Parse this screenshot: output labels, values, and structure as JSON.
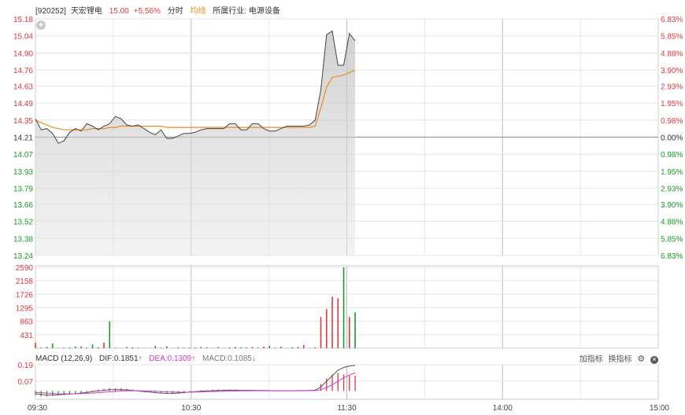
{
  "header": {
    "code": "[920252]",
    "name": "天宏锂电",
    "price": "15.00",
    "change_pct": "+5.56%",
    "mode": "分时",
    "avg_label": "均线",
    "industry_label": "所属行业: 电源设备"
  },
  "macd_header": {
    "title": "MACD (12,26,9)",
    "dif": "DIF:0.1851",
    "dif_arrow": "↑",
    "dea": "DEA:0.1309",
    "dea_arrow": "↑",
    "macd": "MACD:0.1085",
    "macd_arrow": "↓"
  },
  "toolbar": {
    "add_indicator": "加指标",
    "switch_indicator": "换指标"
  },
  "icons": {
    "expand": "plus-circle-icon",
    "settings": "gear-icon",
    "close": "close-icon"
  },
  "colors": {
    "up": "#e0393e",
    "down": "#1a9a2a",
    "price_line": "#444444",
    "avg_line": "#f08a20",
    "dea_line": "#d63ad0",
    "grid": "#d9d9d9"
  },
  "chart_data": [
    {
      "type": "line",
      "x_ticks": [
        "09:30",
        "10:30",
        "11:30",
        "14:00",
        "15:00"
      ],
      "y_ticks_left": [
        "15.18",
        "15.04",
        "14.90",
        "14.76",
        "14.63",
        "14.49",
        "14.35",
        "14.21",
        "14.07",
        "13.93",
        "13.79",
        "13.66",
        "13.52",
        "13.38",
        "13.24"
      ],
      "y_ticks_right": [
        "6.83%",
        "5.85%",
        "4.88%",
        "3.90%",
        "2.93%",
        "1.95%",
        "0.98%",
        "0.00%",
        "0.98%",
        "1.95%",
        "2.93%",
        "3.90%",
        "4.88%",
        "5.85%",
        "6.83%"
      ],
      "ylim": [
        13.24,
        15.18
      ],
      "prev_close": 14.21,
      "series": [
        {
          "values": [
            14.36,
            14.27,
            14.28,
            14.24,
            14.16,
            14.18,
            14.25,
            14.28,
            14.26,
            14.32,
            14.3,
            14.27,
            14.3,
            14.32,
            14.38,
            14.36,
            14.31,
            14.3,
            14.31,
            14.28,
            14.25,
            14.23,
            14.27,
            14.2,
            14.2,
            14.22,
            14.24,
            14.24,
            14.25,
            14.27,
            14.28,
            14.28,
            14.28,
            14.28,
            14.32,
            14.32,
            14.27,
            14.27,
            14.32,
            14.32,
            14.28,
            14.26,
            14.26,
            14.28,
            14.3,
            14.3,
            14.3,
            14.3,
            14.31,
            14.35,
            14.6,
            15.05,
            15.08,
            14.8,
            14.8,
            15.06,
            15.0
          ]
        },
        {
          "values": [
            14.35,
            14.33,
            14.31,
            14.29,
            14.28,
            14.27,
            14.27,
            14.27,
            14.27,
            14.27,
            14.28,
            14.28,
            14.28,
            14.29,
            14.29,
            14.3,
            14.3,
            14.3,
            14.3,
            14.3,
            14.3,
            14.3,
            14.3,
            14.29,
            14.29,
            14.29,
            14.29,
            14.29,
            14.29,
            14.29,
            14.29,
            14.29,
            14.29,
            14.29,
            14.29,
            14.29,
            14.29,
            14.29,
            14.29,
            14.29,
            14.29,
            14.29,
            14.29,
            14.29,
            14.29,
            14.29,
            14.29,
            14.29,
            14.29,
            14.3,
            14.45,
            14.62,
            14.7,
            14.71,
            14.72,
            14.74,
            14.76
          ]
        }
      ]
    },
    {
      "type": "bar",
      "y_ticks": [
        "2590",
        "2158",
        "1726",
        "1295",
        "863",
        "431"
      ],
      "ylim": [
        0,
        2590
      ],
      "values": [
        180,
        20,
        40,
        150,
        10,
        20,
        30,
        50,
        60,
        20,
        120,
        30,
        180,
        860,
        20,
        10,
        40,
        30,
        20,
        10,
        10,
        80,
        20,
        60,
        10,
        30,
        20,
        20,
        30,
        40,
        30,
        10,
        40,
        10,
        30,
        40,
        30,
        30,
        40,
        20,
        50,
        80,
        20,
        50,
        10,
        30,
        40,
        100,
        10,
        30,
        1000,
        1250,
        1650,
        1600,
        2590,
        1000,
        1150
      ],
      "up": [
        true,
        false,
        false,
        false,
        false,
        true,
        true,
        false,
        true,
        false,
        false,
        true,
        true,
        false,
        false,
        true,
        false,
        true,
        false,
        true,
        false,
        false,
        true,
        false,
        true,
        false,
        true,
        false,
        true,
        false,
        true,
        false,
        true,
        false,
        true,
        false,
        true,
        false,
        true,
        false,
        true,
        false,
        true,
        false,
        true,
        false,
        true,
        true,
        false,
        true,
        true,
        true,
        true,
        true,
        false,
        true,
        false
      ]
    },
    {
      "type": "bar",
      "y_ticks": [
        "0.19",
        "0.07"
      ],
      "ylim": [
        -0.06,
        0.19
      ],
      "macd": [
        -0.03,
        -0.04,
        -0.04,
        -0.035,
        -0.03,
        -0.03,
        -0.025,
        -0.02,
        -0.015,
        -0.01,
        0.005,
        0.01,
        0.015,
        0.02,
        0.02,
        0.02,
        0.015,
        0.01,
        0.005,
        0.0,
        -0.005,
        -0.01,
        -0.015,
        -0.02,
        -0.02,
        -0.015,
        -0.01,
        -0.005,
        0.0,
        0.005,
        0.005,
        0.01,
        0.01,
        0.01,
        0.01,
        0.01,
        0.005,
        0.005,
        0.005,
        0.005,
        0.005,
        0.005,
        0.0,
        0.0,
        0.0,
        0.0,
        0.005,
        0.005,
        0.005,
        0.01,
        0.05,
        0.09,
        0.12,
        0.13,
        0.12,
        0.11,
        0.11
      ],
      "dif": [
        -0.02,
        -0.025,
        -0.03,
        -0.03,
        -0.028,
        -0.025,
        -0.022,
        -0.02,
        -0.015,
        -0.01,
        -0.005,
        0.0,
        0.005,
        0.01,
        0.01,
        0.01,
        0.008,
        0.005,
        0.0,
        -0.005,
        -0.008,
        -0.012,
        -0.015,
        -0.018,
        -0.018,
        -0.015,
        -0.012,
        -0.008,
        -0.005,
        -0.002,
        0.0,
        0.002,
        0.004,
        0.005,
        0.006,
        0.006,
        0.005,
        0.005,
        0.005,
        0.004,
        0.004,
        0.003,
        0.002,
        0.002,
        0.002,
        0.002,
        0.003,
        0.003,
        0.004,
        0.006,
        0.03,
        0.07,
        0.11,
        0.15,
        0.17,
        0.18,
        0.1851
      ],
      "dea": [
        -0.01,
        -0.012,
        -0.015,
        -0.018,
        -0.02,
        -0.021,
        -0.021,
        -0.02,
        -0.019,
        -0.017,
        -0.015,
        -0.012,
        -0.009,
        -0.006,
        -0.003,
        0.0,
        0.001,
        0.002,
        0.002,
        0.001,
        0.0,
        -0.002,
        -0.004,
        -0.006,
        -0.008,
        -0.009,
        -0.009,
        -0.009,
        -0.008,
        -0.007,
        -0.005,
        -0.004,
        -0.003,
        -0.002,
        -0.001,
        0.0,
        0.001,
        0.001,
        0.002,
        0.002,
        0.002,
        0.002,
        0.002,
        0.002,
        0.002,
        0.002,
        0.002,
        0.002,
        0.003,
        0.003,
        0.01,
        0.025,
        0.045,
        0.07,
        0.095,
        0.115,
        0.1309
      ]
    }
  ]
}
